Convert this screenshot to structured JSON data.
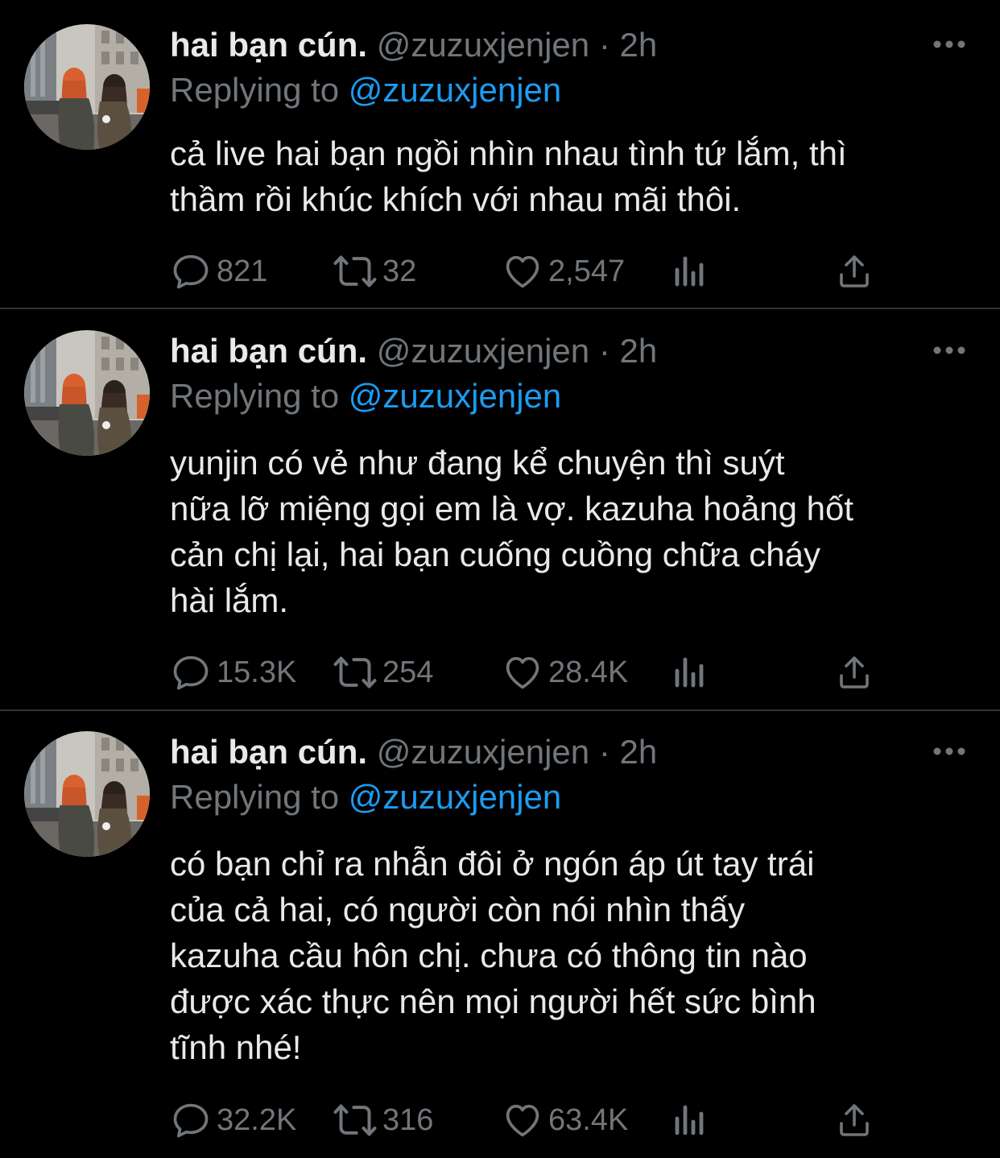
{
  "theme": {
    "background": "#000000",
    "text": "#e7e9ea",
    "muted": "#71767b",
    "link": "#1d9bf0",
    "divider": "#2f3336"
  },
  "tweets": [
    {
      "name": "hai bạn cún.",
      "handle": "@zuzuxjenjen",
      "separator": "·",
      "time": "2h",
      "replying_prefix": "Replying to",
      "replying_to": "@zuzuxjenjen",
      "lines": [
        "cả live hai bạn ngồi nhìn nhau tình tứ lắm, thì",
        "thầm rồi khúc khích với nhau mãi thôi."
      ],
      "replies": "821",
      "retweets": "32",
      "likes": "2,547",
      "icons": [
        "reply-icon",
        "retweet-icon",
        "like-icon",
        "views-icon",
        "share-icon",
        "more-icon"
      ]
    },
    {
      "name": "hai bạn cún.",
      "handle": "@zuzuxjenjen",
      "separator": "·",
      "time": "2h",
      "replying_prefix": "Replying to",
      "replying_to": "@zuzuxjenjen",
      "lines": [
        "yunjin có vẻ như đang kể chuyện thì suýt",
        "nữa lỡ miệng gọi em là vợ. kazuha hoảng hốt",
        "cản chị lại, hai bạn cuống cuồng chữa cháy",
        "hài lắm."
      ],
      "replies": "15.3K",
      "retweets": "254",
      "likes": "28.4K",
      "icons": [
        "reply-icon",
        "retweet-icon",
        "like-icon",
        "views-icon",
        "share-icon",
        "more-icon"
      ]
    },
    {
      "name": "hai bạn cún.",
      "handle": "@zuzuxjenjen",
      "separator": "·",
      "time": "2h",
      "replying_prefix": "Replying to",
      "replying_to": "@zuzuxjenjen",
      "lines": [
        "có bạn chỉ ra nhẫn đôi ở ngón áp út tay trái",
        "của cả hai, có người còn nói nhìn thấy",
        "kazuha cầu hôn chị. chưa có thông tin nào",
        "được xác thực nên mọi người hết sức bình",
        "tĩnh nhé!"
      ],
      "replies": "32.2K",
      "retweets": "316",
      "likes": "63.4K",
      "icons": [
        "reply-icon",
        "retweet-icon",
        "like-icon",
        "views-icon",
        "share-icon",
        "more-icon"
      ]
    }
  ]
}
